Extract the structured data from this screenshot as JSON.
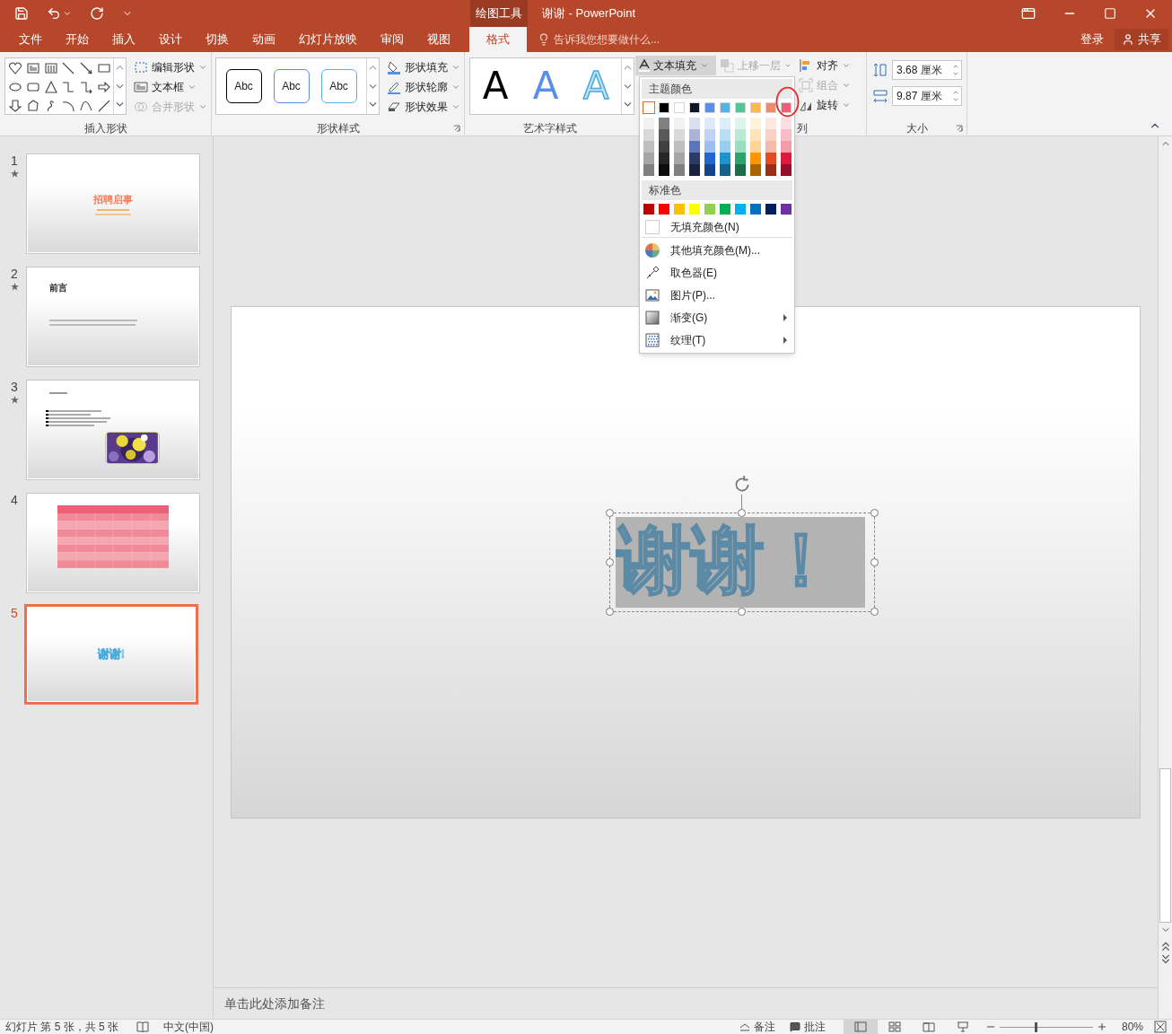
{
  "title_bar": {
    "context_tab": "绘图工具",
    "title": "谢谢 - PowerPoint"
  },
  "ribbon_tabs": [
    {
      "label": "文件",
      "selected": false
    },
    {
      "label": "开始",
      "selected": false
    },
    {
      "label": "插入",
      "selected": false
    },
    {
      "label": "设计",
      "selected": false
    },
    {
      "label": "切换",
      "selected": false
    },
    {
      "label": "动画",
      "selected": false
    },
    {
      "label": "幻灯片放映",
      "selected": false
    },
    {
      "label": "审阅",
      "selected": false
    },
    {
      "label": "视图",
      "selected": false
    },
    {
      "label": "格式",
      "selected": true
    }
  ],
  "tell_me": {
    "placeholder": "告诉我您想要做什么..."
  },
  "account": {
    "sign_in": "登录",
    "share": "共享"
  },
  "ribbon": {
    "insert_shapes": {
      "label": "插入形状",
      "commands": [
        {
          "label": "编辑形状",
          "disabled": false
        },
        {
          "label": "文本框",
          "disabled": false
        },
        {
          "label": "合并形状",
          "disabled": true
        }
      ]
    },
    "shape_styles": {
      "label": "形状样式",
      "presets": [
        {
          "label": "Abc",
          "color": "#000000"
        },
        {
          "label": "Abc",
          "color": "#5b8ee6"
        },
        {
          "label": "Abc",
          "color": "#56b4e4"
        }
      ],
      "commands": [
        {
          "label": "形状填充",
          "kind": "fill"
        },
        {
          "label": "形状轮廓",
          "kind": "outline"
        },
        {
          "label": "形状效果",
          "kind": "effects"
        }
      ]
    },
    "wordart_styles": {
      "label": "艺术字样式",
      "presets": [
        {
          "label": "A",
          "kind": "solid"
        },
        {
          "label": "A",
          "kind": "gradient"
        },
        {
          "label": "A",
          "kind": "outline"
        }
      ],
      "text_fill": {
        "label": "文本填充",
        "pressed": true
      }
    },
    "arrange": {
      "label": "列",
      "commands": [
        {
          "label": "上移一层",
          "disabled": true,
          "kind": "forward"
        },
        {
          "label": "对齐",
          "disabled": false,
          "kind": "align"
        },
        {
          "label": "组合",
          "disabled": true,
          "kind": "group"
        },
        {
          "label": "旋转",
          "disabled": false,
          "kind": "rotate"
        }
      ]
    },
    "size": {
      "label": "大小",
      "height": "3.68 厘米",
      "width": "9.87 厘米"
    }
  },
  "color_menu": {
    "theme_header": "主题颜色",
    "theme_colors": [
      {
        "color": "#ffffff",
        "selected": true,
        "shades": [
          {
            "color": "#f2f2f2"
          },
          {
            "color": "#d9d9d9"
          },
          {
            "color": "#bfbfbf"
          },
          {
            "color": "#a6a6a6"
          },
          {
            "color": "#808080"
          }
        ]
      },
      {
        "color": "#000000",
        "selected": false,
        "shades": [
          {
            "color": "#808080"
          },
          {
            "color": "#595959"
          },
          {
            "color": "#404040"
          },
          {
            "color": "#262626"
          },
          {
            "color": "#0d0d0d"
          }
        ]
      },
      {
        "color": "#ffffff",
        "selected": false,
        "shades": [
          {
            "color": "#f2f2f2"
          },
          {
            "color": "#d9d9d9"
          },
          {
            "color": "#bfbfbf"
          },
          {
            "color": "#a6a6a6"
          },
          {
            "color": "#808080"
          }
        ]
      },
      {
        "color": "#0e1628",
        "selected": false,
        "shades": [
          {
            "color": "#dbe0ef"
          },
          {
            "color": "#aab4d8"
          },
          {
            "color": "#5e74b8"
          },
          {
            "color": "#2c3a66"
          },
          {
            "color": "#1a2240"
          }
        ]
      },
      {
        "color": "#5b8ee6",
        "selected": false,
        "shades": [
          {
            "color": "#deeafa"
          },
          {
            "color": "#bfd4f5"
          },
          {
            "color": "#9dbef0"
          },
          {
            "color": "#2166cf"
          },
          {
            "color": "#16448a"
          }
        ]
      },
      {
        "color": "#56b4e4",
        "selected": false,
        "shades": [
          {
            "color": "#ddeef9"
          },
          {
            "color": "#bbddf4"
          },
          {
            "color": "#99cdee"
          },
          {
            "color": "#1f93cc"
          },
          {
            "color": "#156189"
          }
        ]
      },
      {
        "color": "#52c894",
        "selected": false,
        "shades": [
          {
            "color": "#dcf4e9"
          },
          {
            "color": "#bae9d4"
          },
          {
            "color": "#97dfbe"
          },
          {
            "color": "#2ea26b"
          },
          {
            "color": "#1f6c48"
          }
        ]
      },
      {
        "color": "#ffb84f",
        "selected": false,
        "shades": [
          {
            "color": "#fff1da"
          },
          {
            "color": "#ffe3b9"
          },
          {
            "color": "#ffd495"
          },
          {
            "color": "#ff9500"
          },
          {
            "color": "#aa6300"
          }
        ]
      },
      {
        "color": "#f08a6c",
        "selected": false,
        "shades": [
          {
            "color": "#fce7e1"
          },
          {
            "color": "#f9d0c4"
          },
          {
            "color": "#f6b8a7"
          },
          {
            "color": "#e64a22"
          },
          {
            "color": "#992f16"
          }
        ]
      },
      {
        "color": "#ed5f74",
        "selected": false,
        "shades": [
          {
            "color": "#fbdee3"
          },
          {
            "color": "#f8bcc6"
          },
          {
            "color": "#f49ba9"
          },
          {
            "color": "#dc1a3d"
          },
          {
            "color": "#921128"
          }
        ]
      }
    ],
    "standard_header": "标准色",
    "standard_colors": [
      {
        "color": "#c00000"
      },
      {
        "color": "#ff0000"
      },
      {
        "color": "#ffc000"
      },
      {
        "color": "#ffff00"
      },
      {
        "color": "#92d050"
      },
      {
        "color": "#00b050"
      },
      {
        "color": "#00b0f0"
      },
      {
        "color": "#0070c0"
      },
      {
        "color": "#002060"
      },
      {
        "color": "#7030a0"
      }
    ],
    "items": [
      {
        "label": "无填充颜色(N)",
        "kind": "no_fill",
        "submenu": false
      },
      {
        "label": "其他填充颜色(M)...",
        "kind": "more_colors",
        "submenu": false
      },
      {
        "label": "取色器(E)",
        "kind": "eyedropper",
        "submenu": false
      },
      {
        "label": "图片(P)...",
        "kind": "picture",
        "submenu": false
      },
      {
        "label": "渐变(G)",
        "kind": "gradient",
        "submenu": true
      },
      {
        "label": "纹理(T)",
        "kind": "texture",
        "submenu": true
      }
    ]
  },
  "slides": [
    {
      "number": "1",
      "selected": false,
      "animated": true,
      "kind": "title",
      "title": "招聘启事"
    },
    {
      "number": "2",
      "selected": false,
      "animated": true,
      "kind": "heading",
      "title": "前言"
    },
    {
      "number": "3",
      "selected": false,
      "animated": true,
      "kind": "bullets_picture"
    },
    {
      "number": "4",
      "selected": false,
      "animated": false,
      "kind": "table"
    },
    {
      "number": "5",
      "selected": true,
      "animated": false,
      "kind": "wordart",
      "title": "谢谢!"
    }
  ],
  "slide": {
    "text": "谢谢！"
  },
  "notes": {
    "placeholder": "单击此处添加备注"
  },
  "status_bar": {
    "slide_info": "幻灯片 第 5 张，共 5 张",
    "language": "中文(中国)",
    "notes": "备注",
    "comments": "批注",
    "zoom": "80%",
    "level": 0.38
  }
}
